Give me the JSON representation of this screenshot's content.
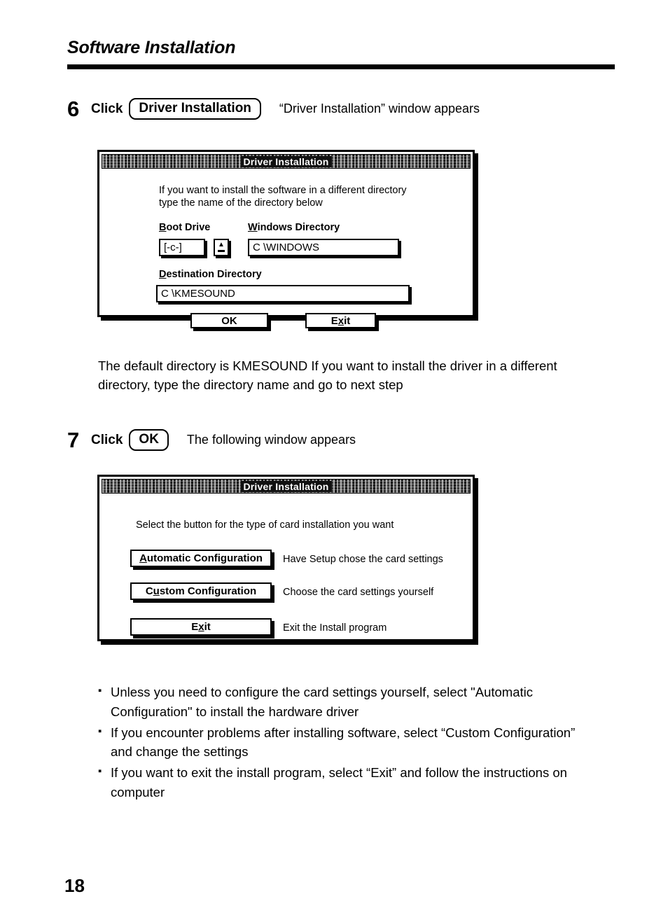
{
  "page": {
    "heading": "Software Installation",
    "folio": "18"
  },
  "steps": [
    {
      "number": "6",
      "verb": "Click",
      "button_label": "Driver Installation",
      "note": "“Driver Installation” window appears"
    },
    {
      "number": "7",
      "verb": "Click",
      "button_label": "OK",
      "note": "The following window appears"
    }
  ],
  "paragraph": {
    "line1": "The default directory is KMESOUND  If you want to install the driver in a different",
    "line2": "directory, type the directory name and go to next step"
  },
  "dialog1": {
    "title": "Driver Installation",
    "instruction_line1": "If you want to install the software in a different directory",
    "instruction_line2": "type the name of the directory below",
    "fields": [
      {
        "label_accel": "B",
        "label_rest": "oot Drive",
        "value": "[-c-]",
        "spinner_up": "▲",
        "spinner_down": "▬"
      },
      {
        "label_accel": "W",
        "label_rest": "indows Directory",
        "value": "C \\WINDOWS"
      },
      {
        "label_accel": "D",
        "label_rest": "estination Directory",
        "value": "C \\KMESOUND"
      }
    ],
    "buttons": [
      {
        "label": "OK"
      },
      {
        "label_pre": "E",
        "label_accel": "x",
        "label_post": "it"
      }
    ]
  },
  "dialog2": {
    "title": "Driver Installation",
    "instruction": "Select the button for the type of card installation you want",
    "options": [
      {
        "label_pre": "",
        "label_accel": "A",
        "label_post": "utomatic Configuration",
        "description": "Have Setup chose the card settings"
      },
      {
        "label_pre": "C",
        "label_accel": "u",
        "label_post": "stom Configuration",
        "description": "Choose the card settings yourself"
      },
      {
        "label_pre": "E",
        "label_accel": "x",
        "label_post": "it",
        "description": "Exit the Install program"
      }
    ]
  },
  "bullets": [
    {
      "mark": "▪",
      "line1": "Unless you need to configure the card settings yourself, select \"Automatic",
      "line2": "Configuration\" to install the hardware driver"
    },
    {
      "mark": "▪",
      "line1": "If you encounter problems after installing software, select “Custom Configuration”",
      "line2": "and change the settings"
    },
    {
      "mark": "▪",
      "line1": "If you want to exit the install program, select “Exit” and follow the instructions on",
      "line2": "computer"
    }
  ]
}
